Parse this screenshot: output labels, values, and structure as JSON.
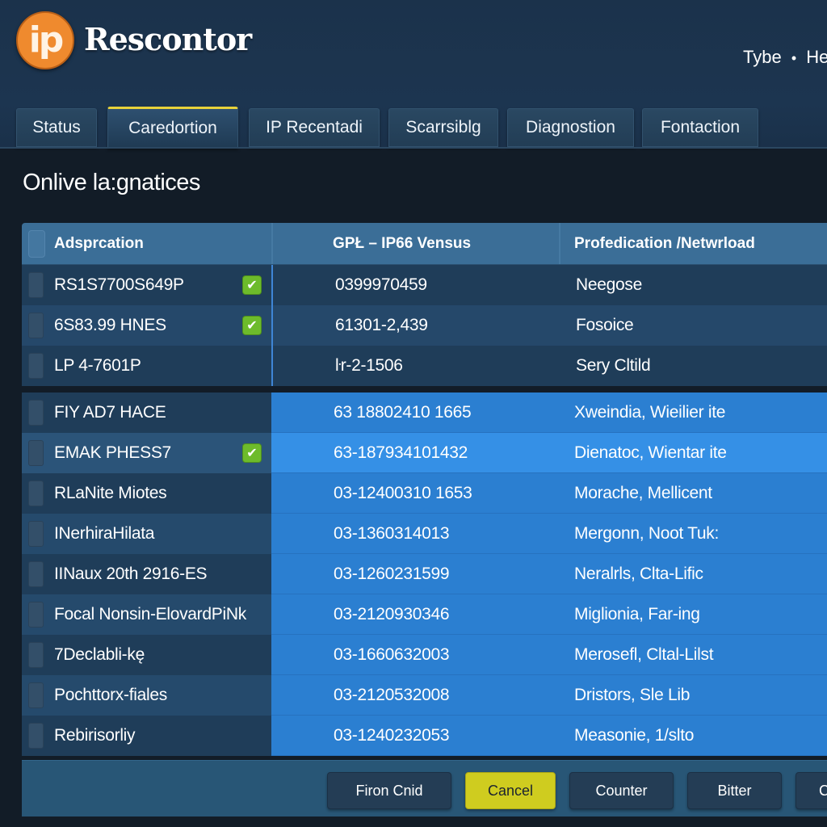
{
  "app": {
    "logo_text": "ip",
    "title": "Rescontor",
    "header_meta": {
      "type_label": "Tybe",
      "separator": "•",
      "help_label": "He"
    }
  },
  "tabs": [
    {
      "label": "Status",
      "active": false
    },
    {
      "label": "Caredortion",
      "active": true
    },
    {
      "label": "IP Recentadi",
      "active": false
    },
    {
      "label": "Scarrsiblg",
      "active": false
    },
    {
      "label": "Diagnostion",
      "active": false
    },
    {
      "label": "Fontaction",
      "active": false
    }
  ],
  "section": {
    "title": "Onlive la:gnatices"
  },
  "table": {
    "columns": [
      "Adsprcation",
      "GPŁ – IP66 Vensus",
      "Profedication /Netwrload"
    ],
    "rows_group_a": [
      {
        "application": "RS1S7700S649P",
        "checked": true,
        "ip": "0399970459",
        "location": "Neegose"
      },
      {
        "application": "6S83.99 HNES",
        "checked": true,
        "ip": "61301-2,439",
        "location": "Fosoice"
      },
      {
        "application": "LP 4-7601P",
        "checked": false,
        "ip": "ŀr-2-1506",
        "location": "Sery Cltild"
      }
    ],
    "rows_group_b": [
      {
        "application": "FIY AD7 HACE",
        "checked": false,
        "ip": "63 18802410 1665",
        "location": "Xweindia, Wieilier ite"
      },
      {
        "application": "EMAK PHESS7",
        "checked": true,
        "ip": "63-187934101432",
        "location": "Dienatoc, Wientar ite"
      },
      {
        "application": "RLaNite Miotes",
        "checked": false,
        "ip": "03-12400310 1653",
        "location": "Morache, Mellicent"
      },
      {
        "application": "INerhiraHilata",
        "checked": false,
        "ip": "03-1360314013",
        "location": "Mergonn, Noot Tuk:"
      },
      {
        "application": "IINaux 20th 2916-ES",
        "checked": false,
        "ip": "03-1260231599",
        "location": "Neralrls, Clta-Lific"
      },
      {
        "application": "Focal Nonsin-ElovardPiNk",
        "checked": false,
        "ip": "03-2120930346",
        "location": "Miglionia, Far-ing"
      },
      {
        "application": "7Declabli-kę",
        "checked": false,
        "ip": "03-1660632003",
        "location": "Merosefl, Cltal-Lilst"
      },
      {
        "application": "Pochttorx-fiales",
        "checked": false,
        "ip": "03-2120532008",
        "location": "Dristors, Sle Lib"
      },
      {
        "application": "Rebirisorliy",
        "checked": false,
        "ip": "03-1240232053",
        "location": "Measonie, 1/slto"
      }
    ]
  },
  "footer": {
    "buttons": [
      {
        "label": "Firon Cnid",
        "primary": false
      },
      {
        "label": "Cancel",
        "primary": true
      },
      {
        "label": "Counter",
        "primary": false
      },
      {
        "label": "Bitter",
        "primary": false
      },
      {
        "label": "C",
        "primary": false
      }
    ]
  },
  "colors": {
    "accent_orange": "#ef8a2e",
    "active_tab_indicator": "#e8d23a",
    "primary_button": "#cfcc1f",
    "check_green": "#6dbb2b",
    "selection_blue": "#2b7fd1"
  },
  "icons": {
    "status_check": "check-icon",
    "logo": "ip-logo-icon"
  }
}
